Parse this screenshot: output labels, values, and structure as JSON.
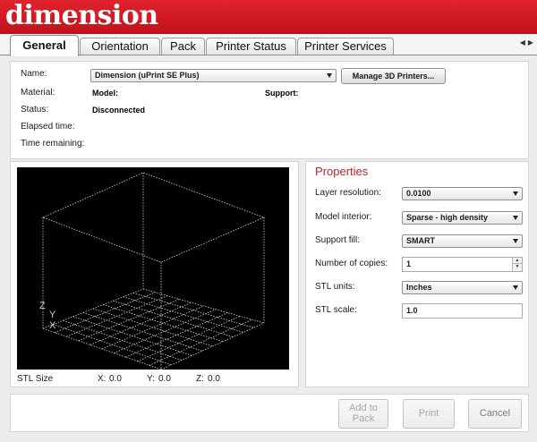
{
  "brand": {
    "logo_text": "dimension",
    "accent": "#d71920"
  },
  "tabs": [
    {
      "label": "General",
      "active": true
    },
    {
      "label": "Orientation",
      "active": false
    },
    {
      "label": "Pack",
      "active": false
    },
    {
      "label": "Printer Status",
      "active": false
    },
    {
      "label": "Printer Services",
      "active": false
    }
  ],
  "tab_scroll": {
    "left_icon": "scroll-left-icon",
    "right_icon": "scroll-right-icon"
  },
  "printer": {
    "name_label": "Name:",
    "name_value": "Dimension  (uPrint SE Plus)",
    "manage_button": "Manage 3D Printers...",
    "material_label": "Material:",
    "model_label": "Model:",
    "support_label": "Support:",
    "status_label": "Status:",
    "status_value": "Disconnected",
    "elapsed_label": "Elapsed time:",
    "remaining_label": "Time remaining:"
  },
  "preview": {
    "axis_labels": [
      "Z",
      "Y",
      "X"
    ],
    "stl_size_label": "STL Size",
    "x_label": "X:",
    "x_value": "0.0",
    "y_label": "Y:",
    "y_value": "0.0",
    "z_label": "Z:",
    "z_value": "0.0"
  },
  "properties": {
    "title": "Properties",
    "title_color": "#c9202a",
    "layer_resolution_label": "Layer resolution:",
    "layer_resolution_value": "0.0100",
    "model_interior_label": "Model interior:",
    "model_interior_value": "Sparse - high density",
    "support_fill_label": "Support fill:",
    "support_fill_value": "SMART",
    "copies_label": "Number of copies:",
    "copies_value": "1",
    "stl_units_label": "STL units:",
    "stl_units_value": "Inches",
    "stl_scale_label": "STL scale:",
    "stl_scale_value": "1.0"
  },
  "actions": {
    "add_to_pack_line1": "Add to",
    "add_to_pack_line2": "Pack",
    "print": "Print",
    "cancel": "Cancel"
  }
}
